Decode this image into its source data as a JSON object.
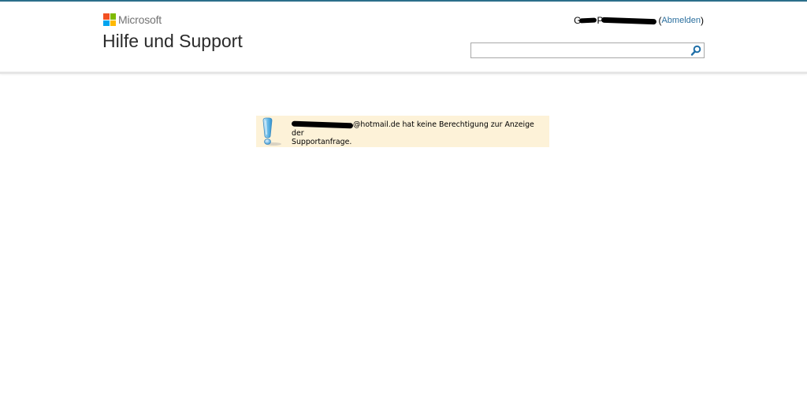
{
  "brand": {
    "logo_text": "Microsoft",
    "colors": [
      "#f25022",
      "#7fba00",
      "#00a4ef",
      "#ffb900"
    ]
  },
  "header": {
    "title": "Hilfe und Support",
    "user": {
      "name_visible_start": "G",
      "name_visible_mid": "P",
      "open_paren": "(",
      "signout_label": "Abmelden",
      "close_paren": ")"
    },
    "search": {
      "value": "",
      "placeholder": "",
      "icon": "search-icon"
    }
  },
  "notice": {
    "icon": "exclamation-icon",
    "email_suffix": "@hotmail.de",
    "message_line1": " hat keine Berechtigung zur Anzeige der",
    "message_line2": "Supportanfrage."
  }
}
